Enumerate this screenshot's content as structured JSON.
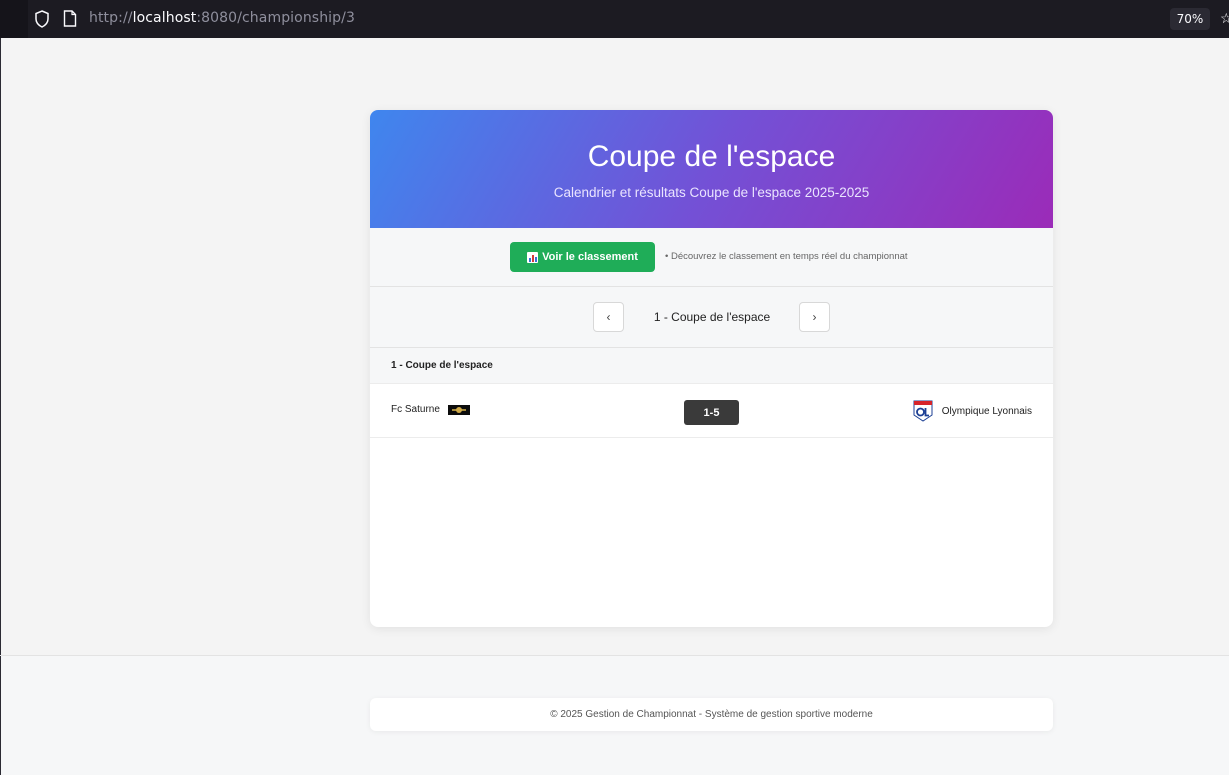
{
  "browser": {
    "url_scheme": "http://",
    "url_host": "localhost",
    "url_rest": ":8080/championship/3",
    "zoom": "70%"
  },
  "header": {
    "title": "Coupe de l'espace",
    "subtitle": "Calendrier et résultats Coupe de l'espace 2025-2025"
  },
  "actions": {
    "ranking_button_label": "Voir le classement",
    "hint": "• Découvrez le classement en temps réel du championnat"
  },
  "round_nav": {
    "prev": "‹",
    "next": "›",
    "current": "1 - Coupe de l'espace"
  },
  "group": {
    "title": "1 - Coupe de l'espace",
    "matches": [
      {
        "home": "Fc Saturne",
        "score": "1-5",
        "away": "Olympique Lyonnais"
      }
    ]
  },
  "footer": {
    "text": "© 2025 Gestion de Championnat - Système de gestion sportive moderne"
  },
  "colors": {
    "gradient_start": "#3f86ee",
    "gradient_end": "#9b2bb8",
    "ranking_button": "#1fad58",
    "score_badge": "#3a3a3a"
  },
  "icons": [
    "shield-icon",
    "page-icon",
    "star-icon",
    "chart-icon",
    "fc-saturne-logo",
    "olympique-lyonnais-logo"
  ]
}
